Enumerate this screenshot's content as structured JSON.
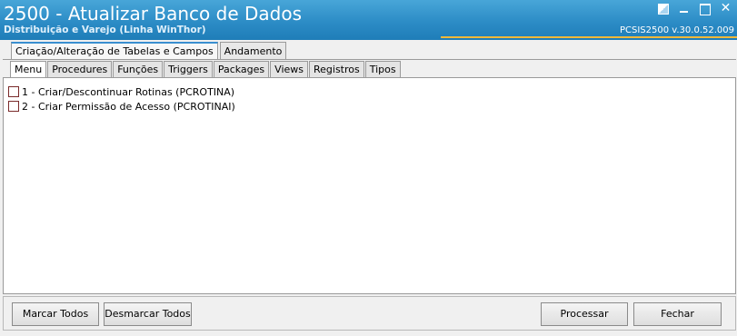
{
  "window": {
    "title": "2500 - Atualizar Banco de Dados",
    "subtitle": "Distribuição e Varejo (Linha WinThor)",
    "version": "PCSIS2500  v.30.0.52.009",
    "close_glyph": "✕",
    "accent_color": "#f0b93a",
    "titlebar_color": "#2c8cc6"
  },
  "outer_tabs": [
    {
      "label": "Criação/Alteração de Tabelas e Campos",
      "active": true
    },
    {
      "label": "Andamento",
      "active": false
    }
  ],
  "inner_tabs": [
    {
      "label": "Menu",
      "active": true
    },
    {
      "label": "Procedures",
      "active": false
    },
    {
      "label": "Funções",
      "active": false
    },
    {
      "label": "Triggers",
      "active": false
    },
    {
      "label": "Packages",
      "active": false
    },
    {
      "label": "Views",
      "active": false
    },
    {
      "label": "Registros",
      "active": false
    },
    {
      "label": "Tipos",
      "active": false
    }
  ],
  "items": [
    {
      "label": "1 - Criar/Descontinuar Rotinas (PCROTINA)",
      "checked": false
    },
    {
      "label": "2 - Criar Permissão de Acesso (PCROTINAI)",
      "checked": false
    }
  ],
  "buttons": {
    "mark_all": "Marcar Todos",
    "unmark_all": "Desmarcar Todos",
    "process": "Processar",
    "close": "Fechar"
  }
}
